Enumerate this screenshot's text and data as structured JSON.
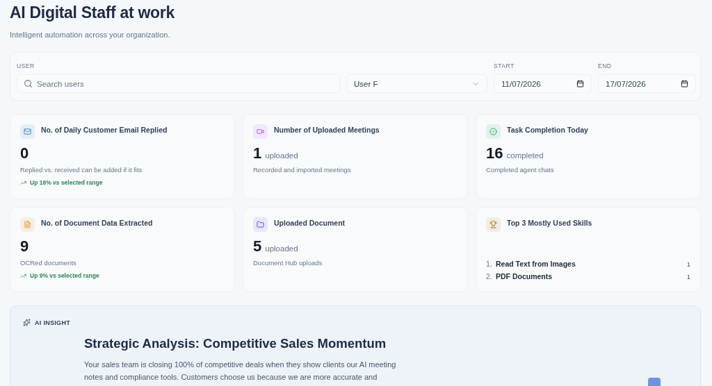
{
  "header": {
    "title": "AI Digital Staff at work",
    "subtitle": "Intelligent automation across your organization."
  },
  "filters": {
    "user_label": "USER",
    "search": {
      "placeholder": "Search users"
    },
    "user_select": {
      "value": "User F"
    },
    "start": {
      "label": "START",
      "value": "11/07/2026"
    },
    "end": {
      "label": "END",
      "value": "17/07/2026"
    }
  },
  "cards": [
    {
      "kind": "email",
      "title": "No. of Daily Customer Email Replied",
      "value": "0",
      "description": "Replied vs. received can be added if it fits",
      "trend": "Up 16% vs selected range"
    },
    {
      "kind": "meetings",
      "title": "Number of Uploaded Meetings",
      "value": "1",
      "unit": "uploaded",
      "description": "Recorded and imported meetings"
    },
    {
      "kind": "tasks",
      "title": "Task Completion Today",
      "value": "16",
      "unit": "completed",
      "description": "Completed agent chats"
    },
    {
      "kind": "extraction",
      "title": "No. of Document Data Extracted",
      "value": "9",
      "description": "OCRed documents",
      "trend": "Up 9% vs selected range"
    },
    {
      "kind": "documents",
      "title": "Uploaded Document",
      "value": "5",
      "unit": "uploaded",
      "description": "Document Hub uploads"
    },
    {
      "kind": "skills",
      "title": "Top 3 Mostly Used Skills",
      "skills": [
        {
          "rank": "1.",
          "name": "Read Text from Images",
          "count": "1"
        },
        {
          "rank": "2.",
          "name": "PDF Documents",
          "count": "1"
        }
      ]
    }
  ],
  "insight": {
    "label": "AI INSIGHT",
    "title": "Strategic Analysis: Competitive Sales Momentum",
    "body": "Your sales team is closing 100% of competitive deals when they show clients our AI meeting notes and compliance tools. Customers choose us because we are more accurate and"
  }
}
